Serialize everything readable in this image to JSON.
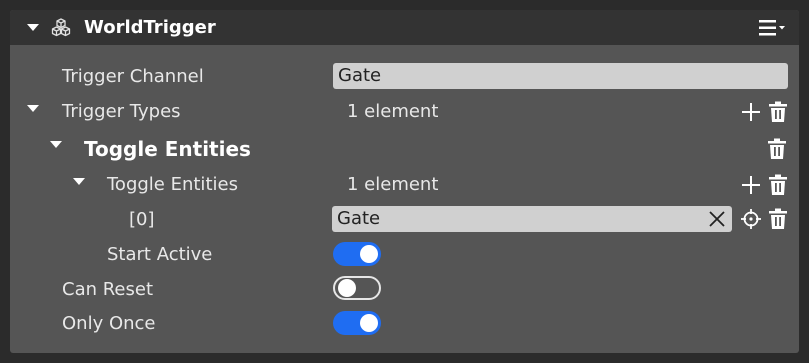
{
  "header": {
    "title": "WorldTrigger"
  },
  "fields": {
    "trigger_channel": {
      "label": "Trigger Channel",
      "value": "Gate"
    },
    "trigger_types": {
      "label": "Trigger Types",
      "count": "1 element"
    },
    "toggle_entities_section": {
      "title": "Toggle Entities"
    },
    "toggle_entities": {
      "label": "Toggle Entities",
      "count": "1 element"
    },
    "entity_0": {
      "label": "[0]",
      "value": "Gate"
    },
    "start_active": {
      "label": "Start Active",
      "on": true
    },
    "can_reset": {
      "label": "Can Reset",
      "on": false
    },
    "only_once": {
      "label": "Only Once",
      "on": true
    }
  },
  "colors": {
    "panel_bg": "#555555",
    "header_bg": "#333333",
    "toggle_on": "#1f6df2",
    "field_bg": "#d0d0d0"
  },
  "icons": [
    "collapse-triangle-icon",
    "component-cubes-icon",
    "menu-options-icon",
    "add-icon",
    "trash-icon",
    "target-picker-icon",
    "clear-x-icon"
  ]
}
